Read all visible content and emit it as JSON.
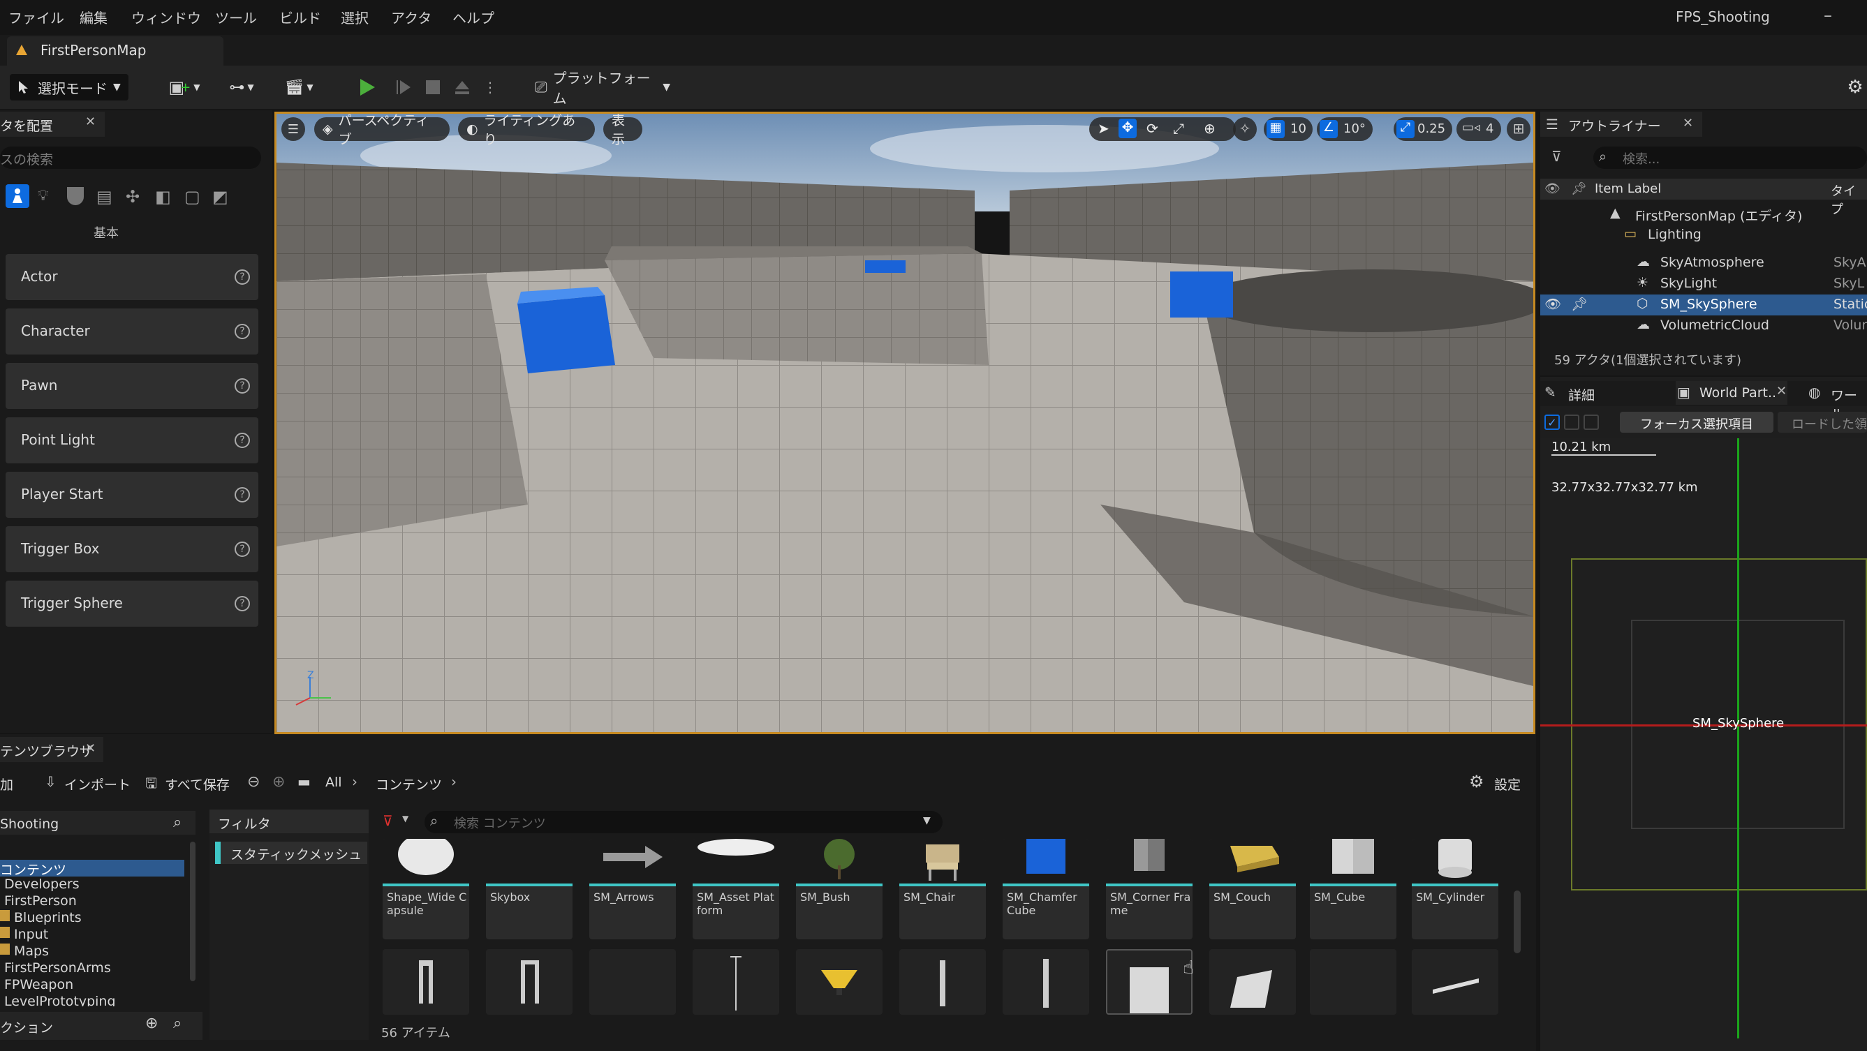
{
  "menu": [
    "ファイル",
    "編集",
    "ウィンドウ",
    "ツール",
    "ビルド",
    "選択",
    "アクタ",
    "ヘルプ"
  ],
  "project_name": "FPS_Shooting",
  "map_tab": "FirstPersonMap",
  "toolbar": {
    "select_mode": "選択モード",
    "platform": "プラットフォーム"
  },
  "place_actors": {
    "tab": "タを配置",
    "search_placeholder": "スの検索",
    "category": "基本",
    "items": [
      "Actor",
      "Character",
      "Pawn",
      "Point Light",
      "Player Start",
      "Trigger Box",
      "Trigger Sphere"
    ]
  },
  "viewport": {
    "perspective": "パースペクティブ",
    "lighting": "ライティングあり",
    "show": "表示",
    "grid_snap": "10",
    "rot_snap": "10°",
    "scale_snap": "0.25",
    "cam_speed": "4",
    "axis_z": "Z"
  },
  "outliner": {
    "title": "アウトライナー",
    "search_placeholder": "検索...",
    "col_label": "Item Label",
    "col_type": "タイプ",
    "rows": [
      {
        "label": "FirstPersonMap (エディタ)",
        "type": ""
      },
      {
        "label": "Lighting",
        "type": ""
      },
      {
        "label": "SkyAtmosphere",
        "type": "SkyA"
      },
      {
        "label": "SkyLight",
        "type": "SkyL"
      },
      {
        "label": "SM_SkySphere",
        "type": "Static"
      },
      {
        "label": "VolumetricCloud",
        "type": "Volun"
      }
    ],
    "status": "59 アクタ(1個選択されています)"
  },
  "details": {
    "tab_details": "詳細",
    "tab_world_part": "World Part..",
    "tab_world": "ワール",
    "focus_btn": "フォーカス選択項目",
    "load_btn": "ロードした領",
    "scale_label": "10.21 km",
    "size_label": "32.77x32.77x32.77 km",
    "selected_name": "SM_SkySphere"
  },
  "content_browser": {
    "tab": "テンツブラウザ",
    "add": "加",
    "import": "インポート",
    "save_all": "すべて保存",
    "path_all": "All",
    "path_content": "コンテンツ",
    "settings": "設定",
    "tree_root": "Shooting",
    "tree": [
      "コンテンツ",
      "Developers",
      "FirstPerson",
      "Blueprints",
      "Input",
      "Maps",
      "FirstPersonArms",
      "FPWeapon",
      "LevelPrototyping"
    ],
    "collections": "クション",
    "filter_title": "フィルタ",
    "filter_item": "スタティックメッシュ",
    "search_placeholder": "検索 コンテンツ",
    "assets": [
      "Shape_Wide Capsule",
      "Skybox",
      "SM_Arrows",
      "SM_Asset Platform",
      "SM_Bush",
      "SM_Chair",
      "SM_Chamfer Cube",
      "SM_Corner Frame",
      "SM_Couch",
      "SM_Cube",
      "SM_Cylinder"
    ],
    "item_count": "56 アイテム"
  }
}
